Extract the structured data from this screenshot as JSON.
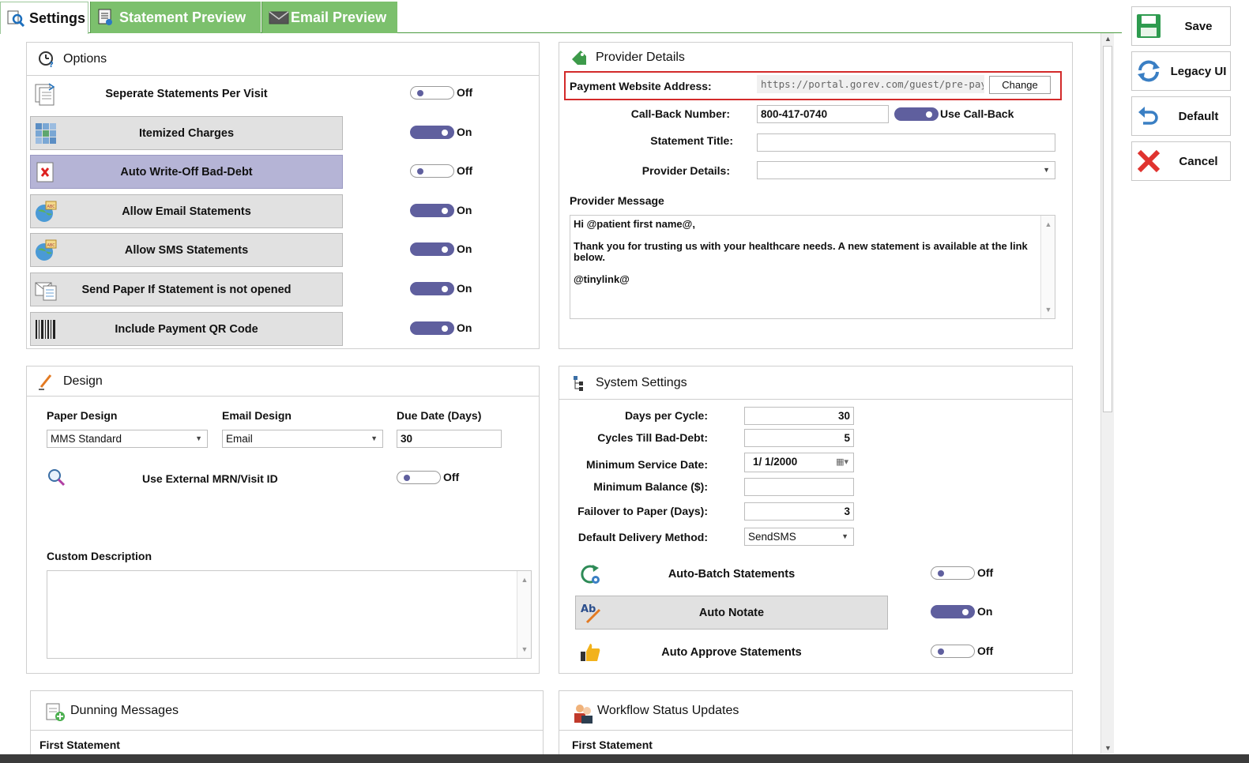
{
  "tabs": {
    "settings": "Settings",
    "statement_preview": "Statement Preview",
    "email_preview": "Email Preview"
  },
  "options": {
    "title": "Options",
    "items": [
      {
        "label": "Seperate Statements Per Visit",
        "state": "Off",
        "on": false
      },
      {
        "label": "Itemized Charges",
        "state": "On",
        "on": true
      },
      {
        "label": "Auto Write-Off Bad-Debt",
        "state": "Off",
        "on": false
      },
      {
        "label": "Allow Email Statements",
        "state": "On",
        "on": true
      },
      {
        "label": "Allow SMS Statements",
        "state": "On",
        "on": true
      },
      {
        "label": "Send Paper If Statement is not opened",
        "state": "On",
        "on": true
      },
      {
        "label": "Include Payment QR Code",
        "state": "On",
        "on": true
      }
    ]
  },
  "provider": {
    "title": "Provider Details",
    "payment_label": "Payment Website Address:",
    "payment_value": "https://portal.gorev.com/guest/pre-payment",
    "change_button": "Change",
    "callback_label": "Call-Back Number:",
    "callback_value": "800-417-0740",
    "use_callback_label": "Use Call-Back",
    "statement_title_label": "Statement Title:",
    "statement_title_value": "",
    "provider_details_label": "Provider Details:",
    "provider_details_value": "",
    "message_label": "Provider Message",
    "message_line1": "Hi @patient first name@,",
    "message_line2": "Thank you for trusting us with your healthcare needs. A new statement is available at the link below.",
    "message_line3": "@tinylink@"
  },
  "design": {
    "title": "Design",
    "paper_label": "Paper Design",
    "paper_value": "MMS Standard",
    "email_label": "Email Design",
    "email_value": "Email",
    "due_label": "Due Date (Days)",
    "due_value": "30",
    "mrn_label": "Use External MRN/Visit ID",
    "mrn_state": "Off",
    "custom_label": "Custom Description",
    "custom_value": ""
  },
  "system": {
    "title": "System Settings",
    "days_label": "Days per Cycle:",
    "days_value": "30",
    "cycles_label": "Cycles Till Bad-Debt:",
    "cycles_value": "5",
    "min_date_label": "Minimum Service Date:",
    "min_date_value": "1/  1/2000",
    "min_balance_label": "Minimum Balance ($):",
    "min_balance_value": "",
    "failover_label": "Failover to Paper (Days):",
    "failover_value": "3",
    "delivery_label": "Default Delivery Method:",
    "delivery_value": "SendSMS",
    "auto_batch_label": "Auto-Batch Statements",
    "auto_batch_state": "Off",
    "auto_notate_label": "Auto Notate",
    "auto_notate_state": "On",
    "auto_approve_label": "Auto Approve Statements",
    "auto_approve_state": "Off"
  },
  "dunning": {
    "title": "Dunning Messages",
    "first": "First Statement"
  },
  "workflow": {
    "title": "Workflow Status Updates",
    "first": "First Statement"
  },
  "actions": {
    "save": "Save",
    "legacy": "Legacy UI",
    "default": "Default",
    "cancel": "Cancel"
  },
  "colors": {
    "tab_green": "#7cc06d",
    "toggle_on": "#5f5f9e",
    "highlight": "#d32a2a"
  }
}
